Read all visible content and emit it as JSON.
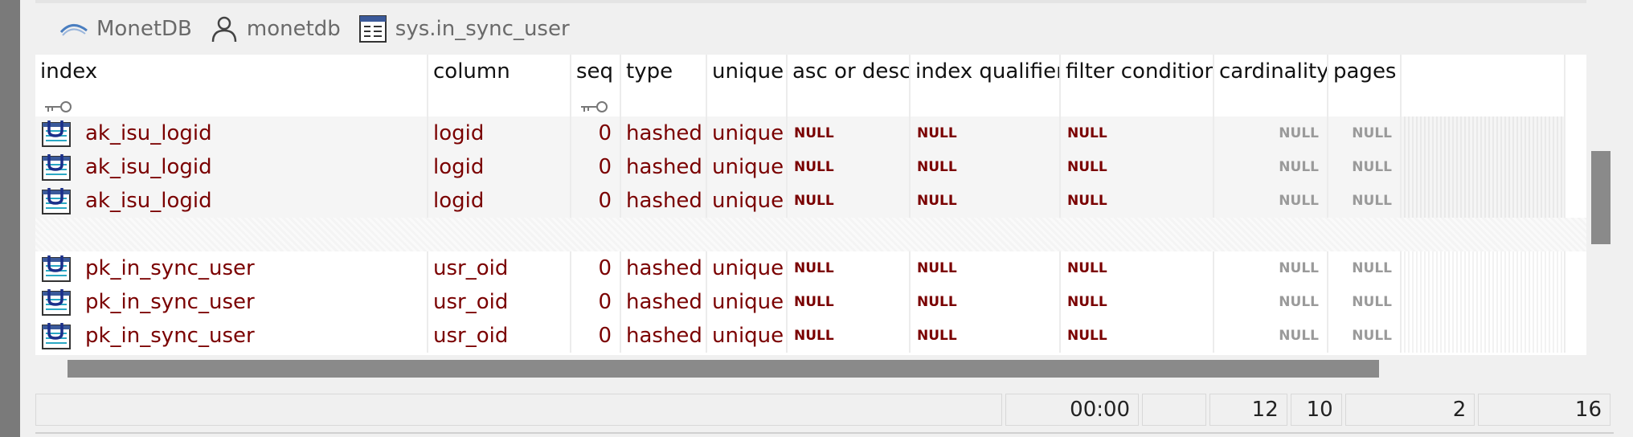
{
  "breadcrumb": {
    "server": "MonetDB",
    "user": "monetdb",
    "table": "sys.in_sync_user",
    "icons": [
      "arc-icon",
      "user-icon",
      "table-icon"
    ]
  },
  "columns": [
    {
      "label": "index",
      "key": true
    },
    {
      "label": "column",
      "key": false
    },
    {
      "label": "seq",
      "key": true
    },
    {
      "label": "type",
      "key": false
    },
    {
      "label": "unique",
      "key": false
    },
    {
      "label": "asc or desc",
      "key": false
    },
    {
      "label": "index qualifier",
      "key": false
    },
    {
      "label": "filter condition",
      "key": false
    },
    {
      "label": "cardinality",
      "key": false
    },
    {
      "label": "pages",
      "key": false
    }
  ],
  "rows": [
    {
      "index": "ak_isu_logid",
      "column": "logid",
      "seq": "0",
      "type": "hashed",
      "unique": "unique",
      "asc_or_desc": "NULL",
      "index_qualifier": "NULL",
      "filter_condition": "NULL",
      "cardinality": "NULL",
      "pages": "NULL"
    },
    {
      "index": "ak_isu_logid",
      "column": "logid",
      "seq": "0",
      "type": "hashed",
      "unique": "unique",
      "asc_or_desc": "NULL",
      "index_qualifier": "NULL",
      "filter_condition": "NULL",
      "cardinality": "NULL",
      "pages": "NULL"
    },
    {
      "index": "ak_isu_logid",
      "column": "logid",
      "seq": "0",
      "type": "hashed",
      "unique": "unique",
      "asc_or_desc": "NULL",
      "index_qualifier": "NULL",
      "filter_condition": "NULL",
      "cardinality": "NULL",
      "pages": "NULL"
    },
    {
      "index": "pk_in_sync_user",
      "column": "usr_oid",
      "seq": "0",
      "type": "hashed",
      "unique": "unique",
      "asc_or_desc": "NULL",
      "index_qualifier": "NULL",
      "filter_condition": "NULL",
      "cardinality": "NULL",
      "pages": "NULL"
    },
    {
      "index": "pk_in_sync_user",
      "column": "usr_oid",
      "seq": "0",
      "type": "hashed",
      "unique": "unique",
      "asc_or_desc": "NULL",
      "index_qualifier": "NULL",
      "filter_condition": "NULL",
      "cardinality": "NULL",
      "pages": "NULL"
    },
    {
      "index": "pk_in_sync_user",
      "column": "usr_oid",
      "seq": "0",
      "type": "hashed",
      "unique": "unique",
      "asc_or_desc": "NULL",
      "index_qualifier": "NULL",
      "filter_condition": "NULL",
      "cardinality": "NULL",
      "pages": "NULL"
    }
  ],
  "status": {
    "time": "00:00",
    "v1": "12",
    "v2": "10",
    "v3": "2",
    "v4": "16"
  },
  "colors": {
    "value_text": "#7a0000",
    "null_right": "#9a9a9a",
    "scrollbar": "#8a8a8a"
  }
}
